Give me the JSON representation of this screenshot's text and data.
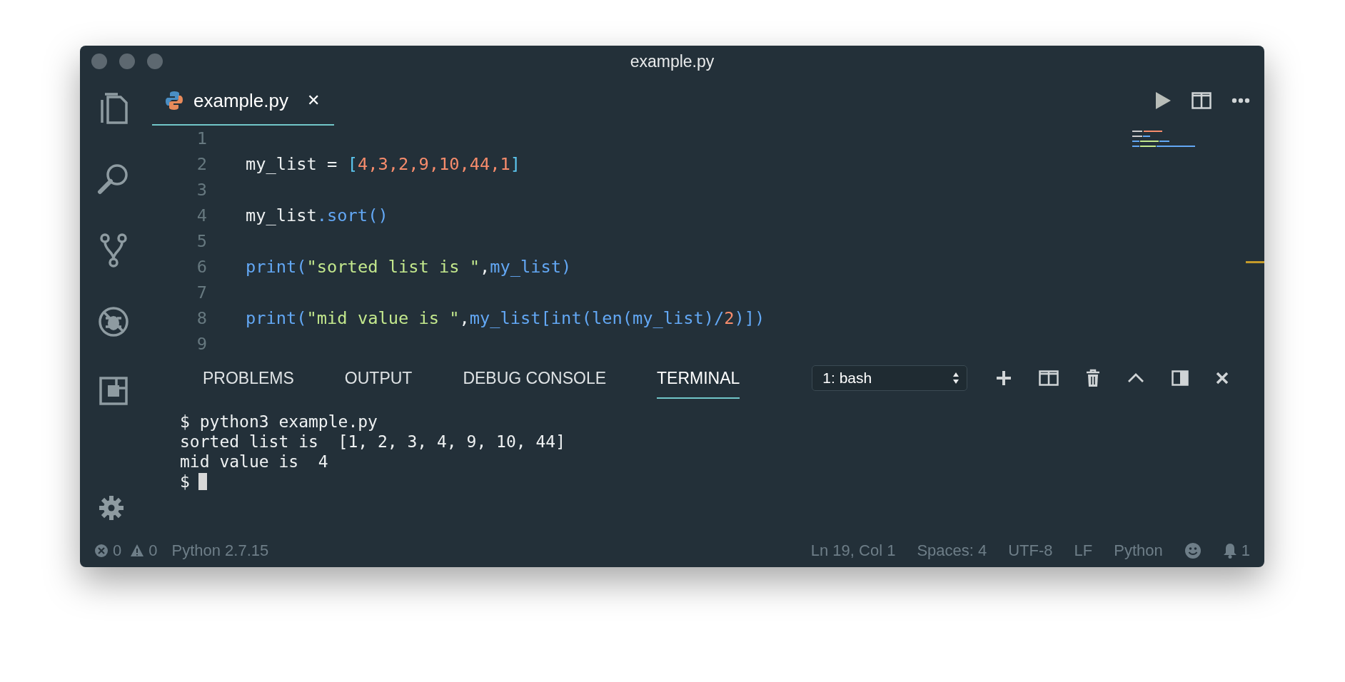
{
  "window": {
    "title": "example.py"
  },
  "editor": {
    "tabs": [
      {
        "label": "example.py",
        "close": "✕",
        "selected": true
      }
    ],
    "lines": [
      {
        "number": "1"
      },
      {
        "number": "2",
        "tokens": [
          {
            "kind": "plain",
            "text": "my_list = "
          },
          {
            "kind": "bracket",
            "text": "["
          },
          {
            "kind": "number",
            "text": "4,3,2,9,10,44,1"
          },
          {
            "kind": "bracket",
            "text": "]"
          }
        ]
      },
      {
        "number": "3"
      },
      {
        "number": "4",
        "tokens": [
          {
            "kind": "plain",
            "text": "my_list"
          },
          {
            "kind": "function",
            "text": ".sort()"
          }
        ]
      },
      {
        "number": "5"
      },
      {
        "number": "6",
        "tokens": [
          {
            "kind": "function",
            "text": "print("
          },
          {
            "kind": "string",
            "text": "\"sorted list is \""
          },
          {
            "kind": "plain",
            "text": ","
          },
          {
            "kind": "function",
            "text": "my_list)"
          }
        ]
      },
      {
        "number": "7"
      },
      {
        "number": "8",
        "tokens": [
          {
            "kind": "function",
            "text": "print("
          },
          {
            "kind": "string",
            "text": "\"mid value is \""
          },
          {
            "kind": "plain",
            "text": ","
          },
          {
            "kind": "function",
            "text": "my_list[int(len(my_list)/"
          },
          {
            "kind": "number",
            "text": "2"
          },
          {
            "kind": "function",
            "text": ")])"
          }
        ]
      },
      {
        "number": "9"
      }
    ]
  },
  "panel": {
    "tabs": [
      {
        "label": "PROBLEMS",
        "selected": false
      },
      {
        "label": "OUTPUT",
        "selected": false
      },
      {
        "label": "DEBUG CONSOLE",
        "selected": false
      },
      {
        "label": "TERMINAL",
        "selected": true
      }
    ],
    "terminal_select": {
      "value": "1: bash"
    },
    "terminal": {
      "lines": [
        "$ python3 example.py",
        "sorted list is  [1, 2, 3, 4, 9, 10, 44]",
        "mid value is  4",
        "$"
      ]
    }
  },
  "status_bar": {
    "errors": "0",
    "warnings": "0",
    "interpreter": "Python 2.7.15",
    "position": "Ln 19, Col 1",
    "indentation": "Spaces: 4",
    "encoding": "UTF-8",
    "line_ending": "LF",
    "language": "Python",
    "notifications": "1"
  }
}
